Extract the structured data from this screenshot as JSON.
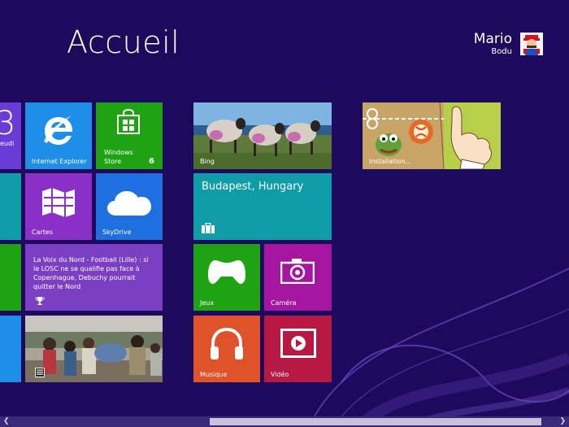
{
  "start": {
    "title": "Accueil"
  },
  "user": {
    "first_name": "Mario",
    "last_name": "Bodu"
  },
  "tiles": {
    "calendar": {
      "day_number": "3",
      "day_label": "eudi"
    },
    "ie": {
      "label": "Internet Explorer"
    },
    "store": {
      "label_line1": "Windows",
      "label_line2": "Store",
      "badge": "6"
    },
    "maps": {
      "label": "Cartes"
    },
    "skydrive": {
      "label": "SkyDrive"
    },
    "news": {
      "headline": "La Voix du Nord - Football (Lille) : si le LOSC ne se qualifie pas face à Copenhague, Debuchy pourrait quitter le Nord"
    },
    "bing": {
      "label": "Bing"
    },
    "travel": {
      "city": "Budapest, Hungary"
    },
    "games": {
      "label": "Jeux"
    },
    "camera": {
      "label": "Caméra"
    },
    "music": {
      "label": "Musique"
    },
    "video": {
      "label": "Vidéo"
    },
    "install": {
      "label": "Installation..."
    }
  },
  "colors": {
    "background": "#1e0a5c",
    "blue": "#1e8ee8",
    "green": "#1fa313",
    "purple": "#8a2fc8",
    "teal": "#0d9ca8",
    "orange": "#e0532a",
    "magenta": "#a4169f"
  }
}
